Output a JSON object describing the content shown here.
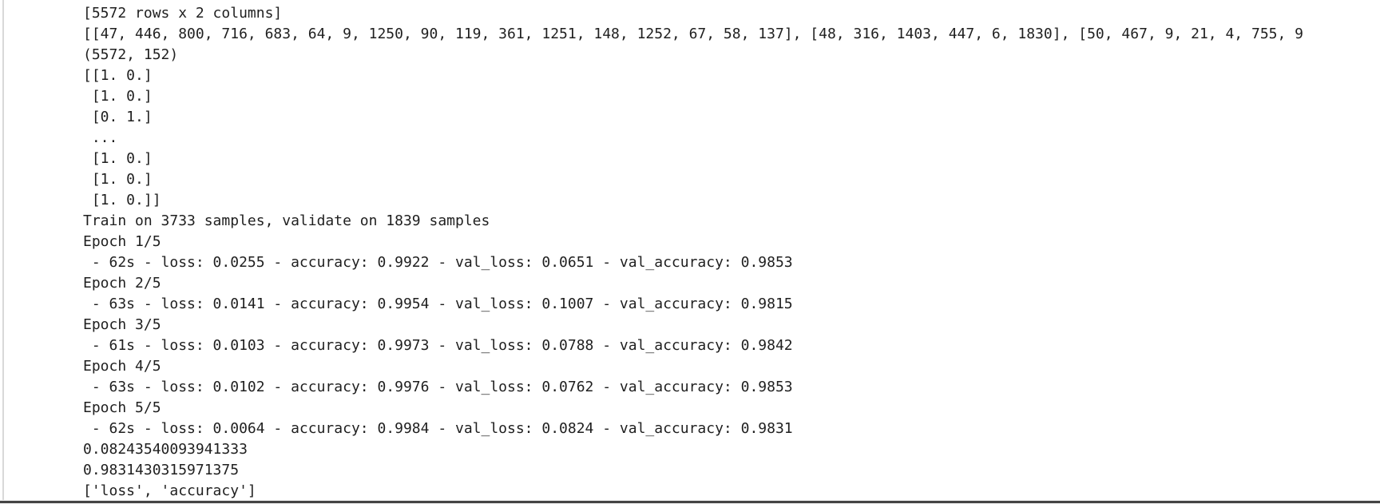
{
  "output": {
    "lines": [
      "[5572 rows x 2 columns]",
      "[[47, 446, 800, 716, 683, 64, 9, 1250, 90, 119, 361, 1251, 148, 1252, 67, 58, 137], [48, 316, 1403, 447, 6, 1830], [50, 467, 9, 21, 4, 755, 9",
      "(5572, 152)",
      "[[1. 0.]",
      " [1. 0.]",
      " [0. 1.]",
      " ...",
      " [1. 0.]",
      " [1. 0.]",
      " [1. 0.]]",
      "Train on 3733 samples, validate on 1839 samples",
      "Epoch 1/5",
      " - 62s - loss: 0.0255 - accuracy: 0.9922 - val_loss: 0.0651 - val_accuracy: 0.9853",
      "Epoch 2/5",
      " - 63s - loss: 0.0141 - accuracy: 0.9954 - val_loss: 0.1007 - val_accuracy: 0.9815",
      "Epoch 3/5",
      " - 61s - loss: 0.0103 - accuracy: 0.9973 - val_loss: 0.0788 - val_accuracy: 0.9842",
      "Epoch 4/5",
      " - 63s - loss: 0.0102 - accuracy: 0.9976 - val_loss: 0.0762 - val_accuracy: 0.9853",
      "Epoch 5/5",
      " - 62s - loss: 0.0064 - accuracy: 0.9984 - val_loss: 0.0824 - val_accuracy: 0.9831",
      "0.08243540093941333",
      "0.9831430315971375",
      "['loss', 'accuracy']"
    ]
  }
}
